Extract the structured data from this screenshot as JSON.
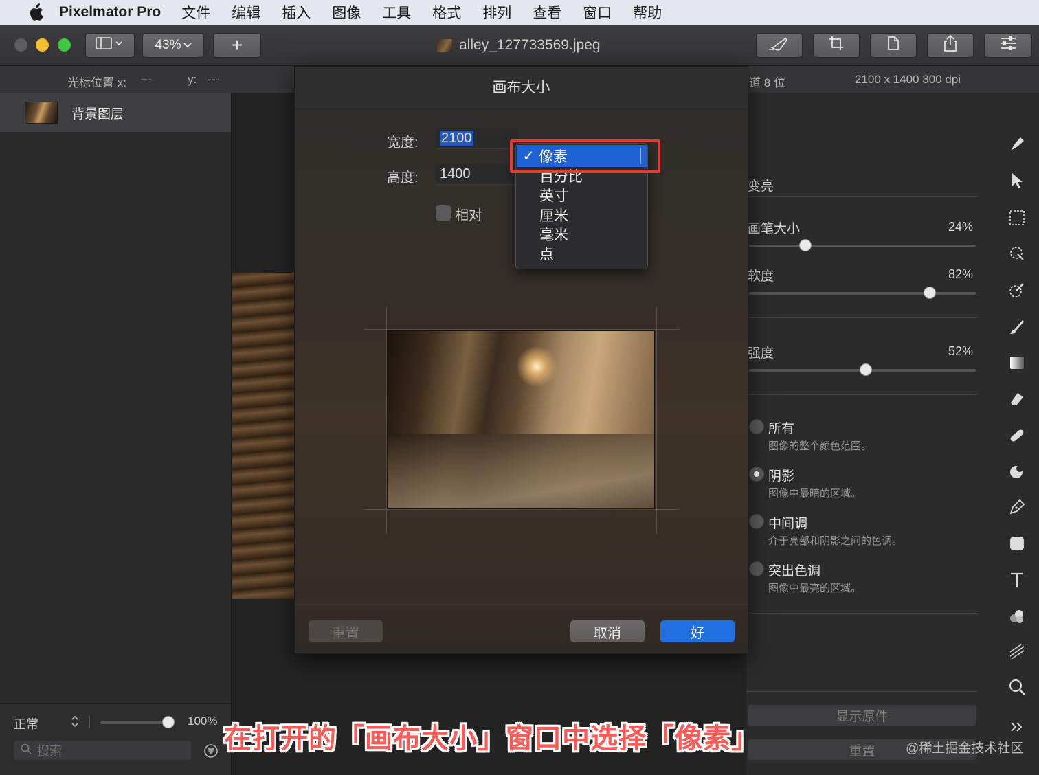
{
  "menubar": {
    "app_name": "Pixelmator Pro",
    "items": [
      "文件",
      "编辑",
      "插入",
      "图像",
      "工具",
      "格式",
      "排列",
      "查看",
      "窗口",
      "帮助"
    ]
  },
  "toolbar": {
    "zoom": "43%",
    "add_label": "+",
    "document_title": "alley_127733569.jpeg"
  },
  "infobar": {
    "cursor_x_label": "光标位置 x:",
    "cursor_x_value": "---",
    "cursor_y_label": "y:",
    "cursor_y_value": "---",
    "channel_info": "道 8 位",
    "image_info": "2100 x 1400 300 dpi"
  },
  "layers": {
    "items": [
      {
        "name": "背景图层"
      }
    ],
    "blend_mode": "正常",
    "opacity": "100%",
    "search_placeholder": "搜索"
  },
  "dialog": {
    "title": "画布大小",
    "width_label": "宽度:",
    "width_value": "2100",
    "height_label": "高度:",
    "height_value": "1400",
    "relative_label": "相对",
    "reset_label": "重置",
    "cancel_label": "取消",
    "ok_label": "好"
  },
  "unit_dropdown": {
    "selected": "像素",
    "check": "✓",
    "options": [
      "像素",
      "百分比",
      "英寸",
      "厘米",
      "毫米",
      "点"
    ]
  },
  "right_panel": {
    "tool_title": "变亮",
    "brush_size_label": "画笔大小",
    "brush_size_value": "24%",
    "softness_label": "软度",
    "softness_value": "82%",
    "strength_label": "强度",
    "strength_value": "52%",
    "range_options": [
      {
        "title": "所有",
        "desc": "图像的整个颜色范围。",
        "selected": false
      },
      {
        "title": "阴影",
        "desc": "图像中最暗的区域。",
        "selected": true
      },
      {
        "title": "中间调",
        "desc": "介于亮部和阴影之间的色调。",
        "selected": false
      },
      {
        "title": "突出色调",
        "desc": "图像中最亮的区域。",
        "selected": false
      }
    ],
    "show_original_label": "显示原件",
    "reset_label": "重置"
  },
  "caption": "在打开的「画布大小」窗口中选择「像素」",
  "watermark": "@稀土掘金技术社区",
  "colors": {
    "accent": "#1f62d4",
    "highlight_box": "#e43a36",
    "caption": "#ff5a55",
    "traffic_close": "#5d5d5f",
    "traffic_min": "#f6be2f",
    "traffic_max": "#3ec640"
  }
}
